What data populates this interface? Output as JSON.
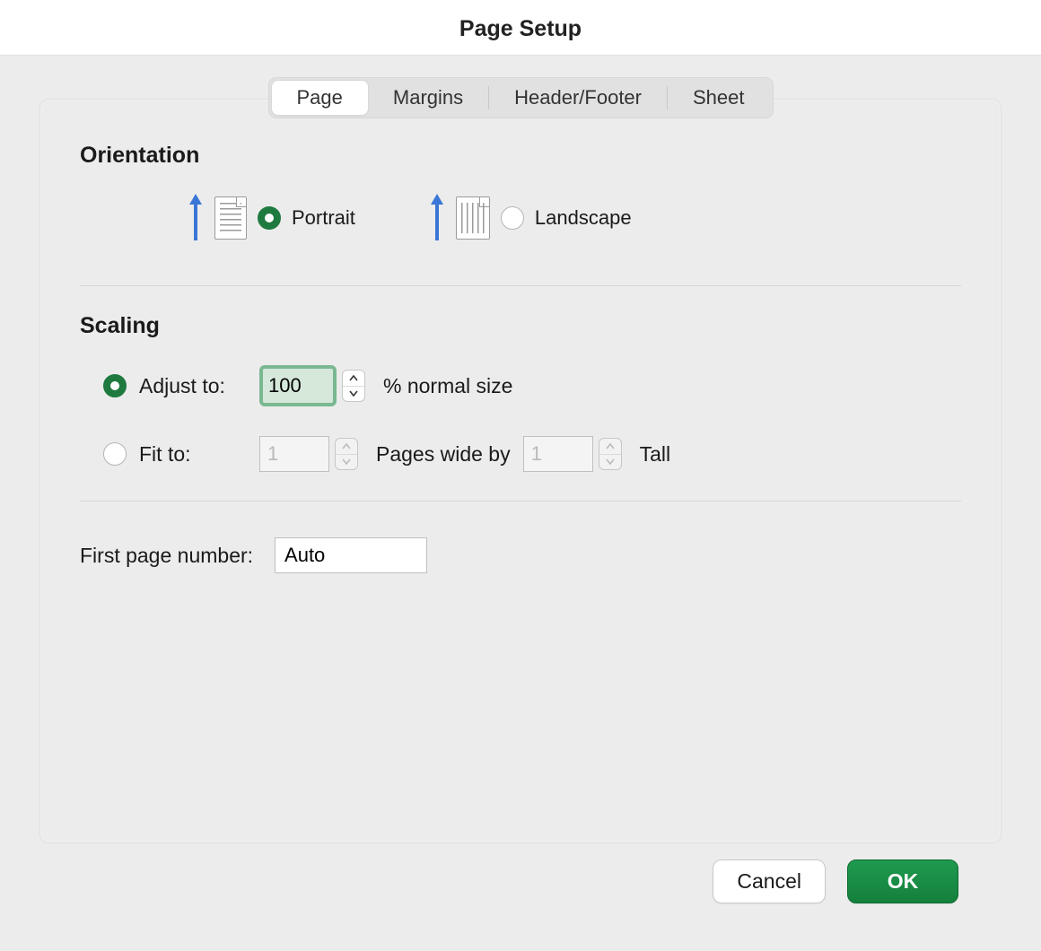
{
  "dialog": {
    "title": "Page Setup",
    "tabs": [
      "Page",
      "Margins",
      "Header/Footer",
      "Sheet"
    ],
    "active_tab": "Page"
  },
  "orientation": {
    "section_title": "Orientation",
    "portrait_label": "Portrait",
    "landscape_label": "Landscape",
    "selected": "portrait"
  },
  "scaling": {
    "section_title": "Scaling",
    "adjust_to_label": "Adjust to:",
    "adjust_value": "100",
    "adjust_suffix": "% normal size",
    "fit_to_label": "Fit to:",
    "fit_wide_value": "1",
    "pages_wide_by": "Pages wide by",
    "fit_tall_value": "1",
    "tall_label": "Tall",
    "selected": "adjust"
  },
  "first_page": {
    "label": "First page number:",
    "value": "Auto"
  },
  "buttons": {
    "cancel": "Cancel",
    "ok": "OK"
  },
  "colors": {
    "accent_green": "#1f7a3f",
    "btn_green_top": "#1f9a4f",
    "btn_green_bottom": "#14803c"
  }
}
